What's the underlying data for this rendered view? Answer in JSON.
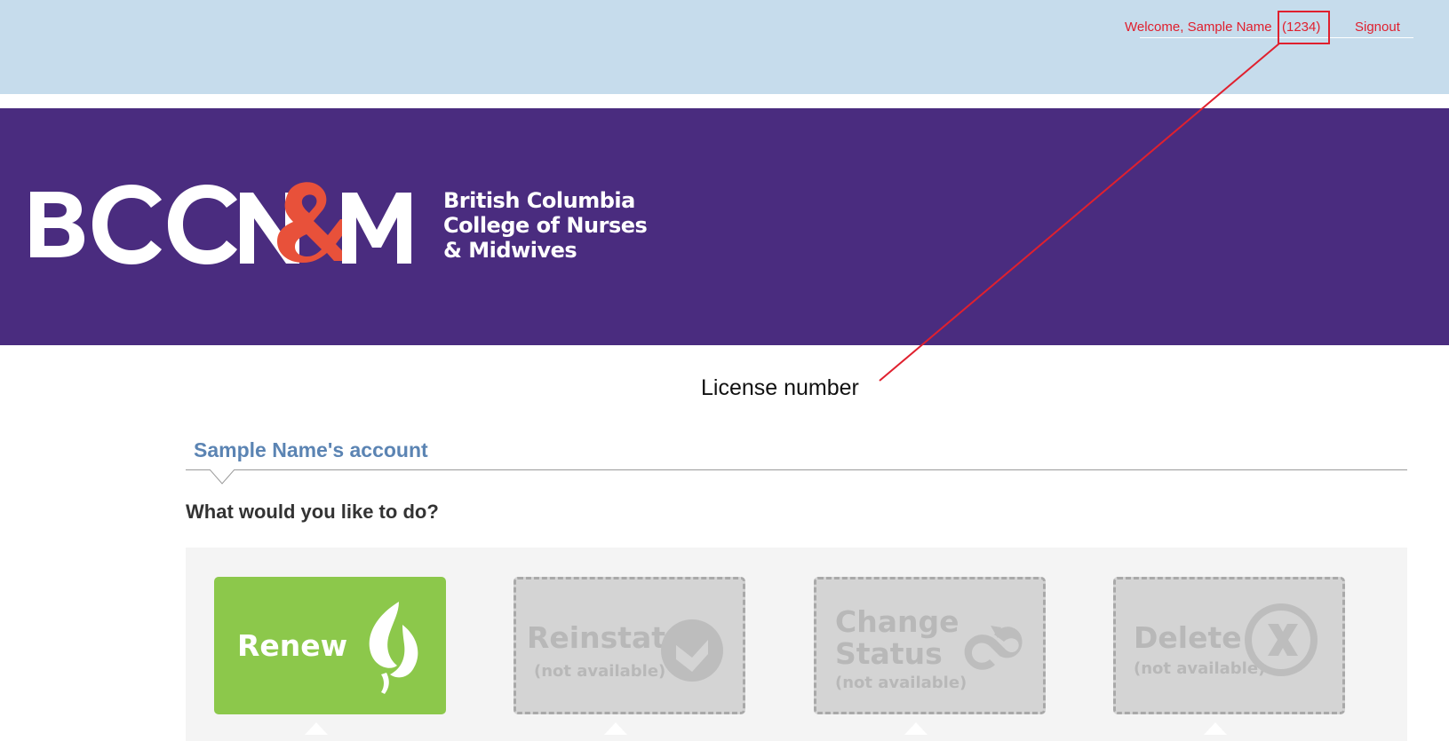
{
  "header": {
    "welcome_text": "Welcome, Sample Name",
    "license_number": "(1234)",
    "signout_label": "Signout"
  },
  "annotation": {
    "label": "License number",
    "color": "#e0202e"
  },
  "branding": {
    "logo_mark": "BCCN&M",
    "logo_text_line1": "British Columbia",
    "logo_text_line2": "College of Nurses",
    "logo_text_line3": "& Midwives",
    "banner_color": "#4a2c7f",
    "accent_color": "#e8513a"
  },
  "account": {
    "title": "Sample Name's account",
    "question": "What would you like to do?"
  },
  "actions": {
    "renew": {
      "label": "Renew",
      "icon": "leaf-icon",
      "color": "#8cc84b"
    },
    "reinstate": {
      "label": "Reinstate",
      "sub": "(not available)",
      "icon": "check-circle-icon"
    },
    "change_status": {
      "label_line1": "Change",
      "label_line2": "Status",
      "sub": "(not available)",
      "icon": "cycle-icon"
    },
    "delete": {
      "label": "Delete",
      "sub": "(not available)",
      "icon": "x-circle-icon"
    }
  }
}
